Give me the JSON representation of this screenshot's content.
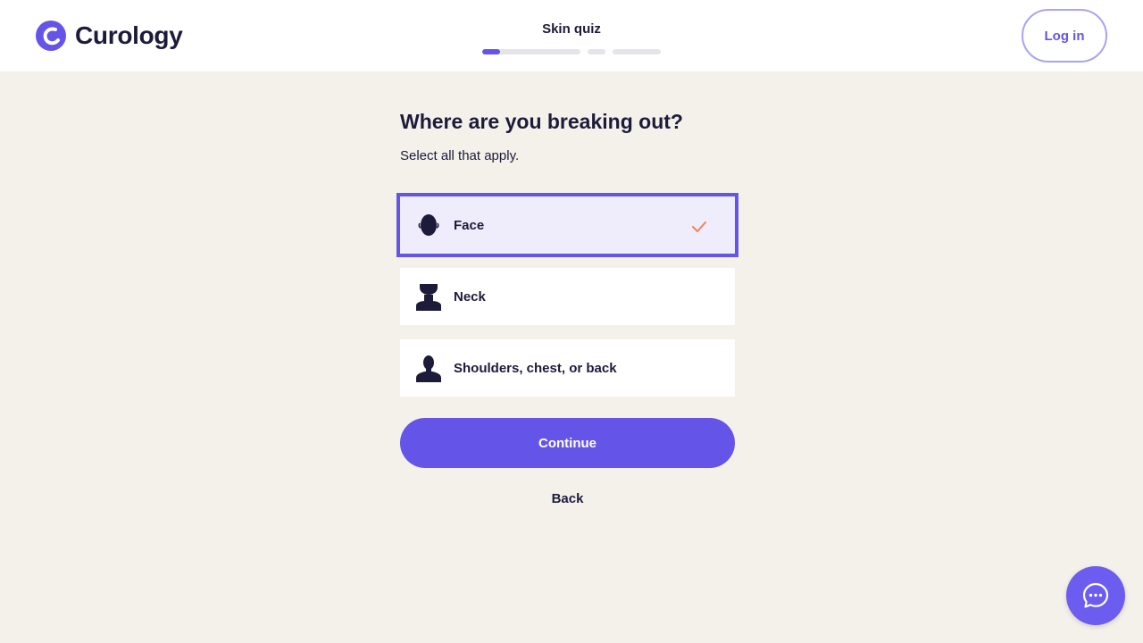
{
  "brand": {
    "name": "Curology",
    "accent": "#6554e8"
  },
  "header": {
    "quiz_title": "Skin quiz",
    "login_label": "Log in",
    "progress": {
      "current_section_fraction": 0.18
    }
  },
  "question": {
    "title": "Where are you breaking out?",
    "hint": "Select all that apply."
  },
  "options": [
    {
      "label": "Face",
      "icon": "face-icon",
      "selected": true
    },
    {
      "label": "Neck",
      "icon": "neck-icon",
      "selected": false
    },
    {
      "label": "Shoulders, chest, or back",
      "icon": "torso-icon",
      "selected": false
    }
  ],
  "actions": {
    "continue_label": "Continue",
    "back_label": "Back"
  },
  "chat": {
    "icon": "chat-icon"
  }
}
